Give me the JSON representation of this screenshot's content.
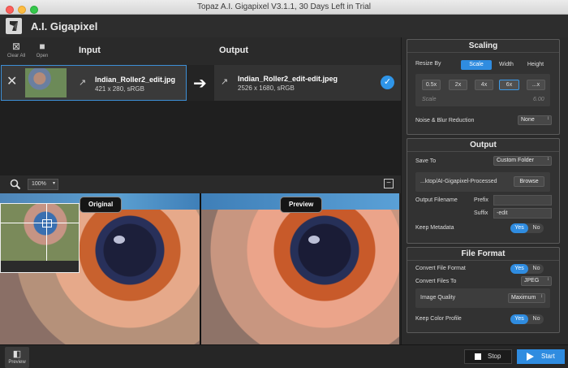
{
  "window": {
    "title": "Topaz A.I. Gigapixel V3.1.1, 30 Days Left in Trial"
  },
  "app": {
    "title": "A.I. Gigapixel"
  },
  "toolbar": {
    "clear_all": "Clear All",
    "open": "Open",
    "input_heading": "Input",
    "output_heading": "Output"
  },
  "input_file": {
    "name": "Indian_Roller2_edit.jpg",
    "meta": "421 x 280, sRGB"
  },
  "output_file": {
    "name": "Indian_Roller2_edit-edit.jpeg",
    "meta": "2526 x 1680, sRGB"
  },
  "viewer": {
    "zoom": "100%",
    "original_label": "Original",
    "preview_label": "Preview"
  },
  "scaling": {
    "title": "Scaling",
    "resize_by_label": "Resize By",
    "resize_modes": [
      "Scale",
      "Width",
      "Height"
    ],
    "active_mode": "Scale",
    "scale_options": [
      "0.5x",
      "2x",
      "4x",
      "6x",
      "...x"
    ],
    "selected_scale": "6x",
    "scale_caption": "Scale",
    "scale_value": "6.00",
    "noise_label": "Noise & Blur Reduction",
    "noise_value": "None"
  },
  "output": {
    "title": "Output",
    "save_to_label": "Save To",
    "save_to_value": "Custom Folder",
    "path": "...ktop/AI-Gigapixel-Processed",
    "browse": "Browse",
    "filename_label": "Output Filename",
    "prefix_label": "Prefix",
    "prefix_value": "",
    "suffix_label": "Suffix",
    "suffix_value": "-edit",
    "keep_metadata_label": "Keep Metadata",
    "yes": "Yes",
    "no": "No"
  },
  "file_format": {
    "title": "File Format",
    "convert_label": "Convert File Format",
    "convert_to_label": "Convert Files To",
    "convert_to_value": "JPEG",
    "quality_label": "Image Quality",
    "quality_value": "Maximum",
    "color_profile_label": "Keep Color Profile",
    "yes": "Yes",
    "no": "No"
  },
  "bottom": {
    "preview": "Preview",
    "stop": "Stop",
    "start": "Start"
  },
  "colors": {
    "accent": "#2f8ce0",
    "panel": "#323232",
    "background": "#232323"
  }
}
